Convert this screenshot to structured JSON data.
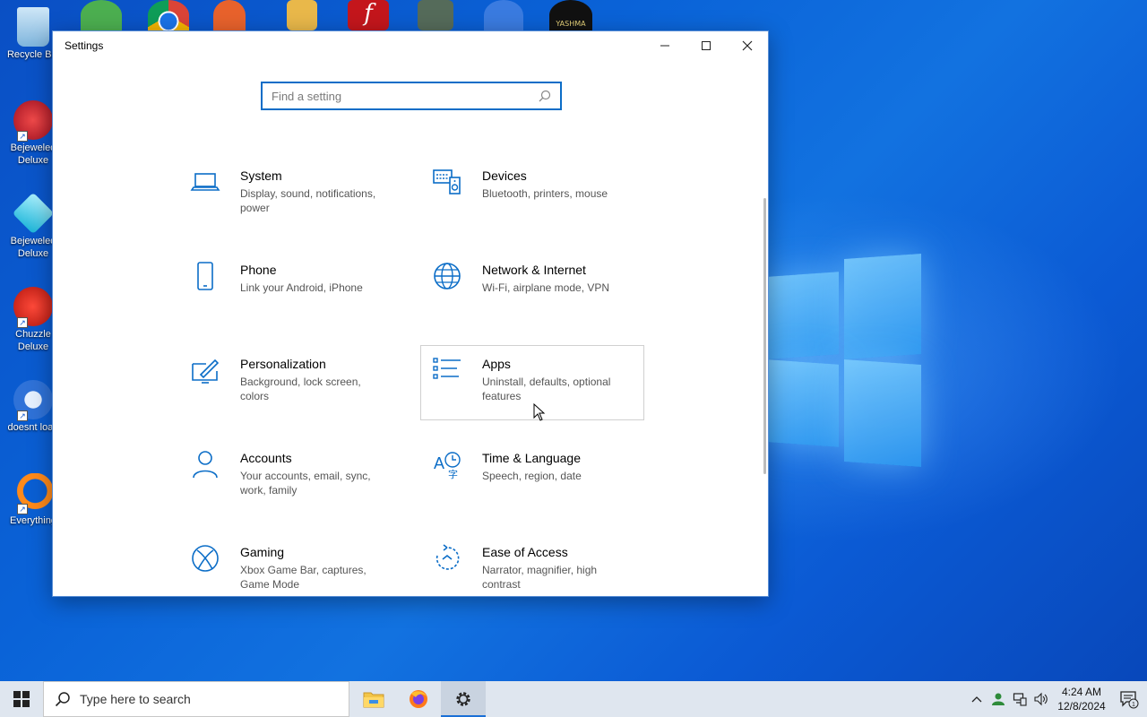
{
  "desktop": {
    "icons": [
      {
        "label": "Recycle Bin"
      },
      {
        "label": "Bejeweled Deluxe"
      },
      {
        "label": "Bejeweled Deluxe"
      },
      {
        "label": "Chuzzle Deluxe"
      },
      {
        "label": "doesnt load"
      },
      {
        "label": "Everything"
      }
    ],
    "top_icon_label": "YASHMA"
  },
  "window": {
    "title": "Settings",
    "search_placeholder": "Find a setting",
    "tiles": [
      {
        "name": "System",
        "desc": "Display, sound, notifications, power",
        "icon": "laptop-icon"
      },
      {
        "name": "Devices",
        "desc": "Bluetooth, printers, mouse",
        "icon": "keyboard-speaker-icon"
      },
      {
        "name": "Phone",
        "desc": "Link your Android, iPhone",
        "icon": "phone-icon"
      },
      {
        "name": "Network & Internet",
        "desc": "Wi-Fi, airplane mode, VPN",
        "icon": "globe-icon"
      },
      {
        "name": "Personalization",
        "desc": "Background, lock screen, colors",
        "icon": "paintbrush-icon"
      },
      {
        "name": "Apps",
        "desc": "Uninstall, defaults, optional features",
        "icon": "apps-list-icon"
      },
      {
        "name": "Accounts",
        "desc": "Your accounts, email, sync, work, family",
        "icon": "person-icon"
      },
      {
        "name": "Time & Language",
        "desc": "Speech, region, date",
        "icon": "time-language-icon"
      },
      {
        "name": "Gaming",
        "desc": "Xbox Game Bar, captures, Game Mode",
        "icon": "xbox-icon"
      },
      {
        "name": "Ease of Access",
        "desc": "Narrator, magnifier, high contrast",
        "icon": "ease-of-access-icon"
      }
    ]
  },
  "taskbar": {
    "search_text": "Type here to search",
    "time": "4:24 AM",
    "date": "12/8/2024",
    "notification_count": "1"
  },
  "colors": {
    "accent": "#0b6dc7",
    "taskbar": "#dfe6ef"
  }
}
